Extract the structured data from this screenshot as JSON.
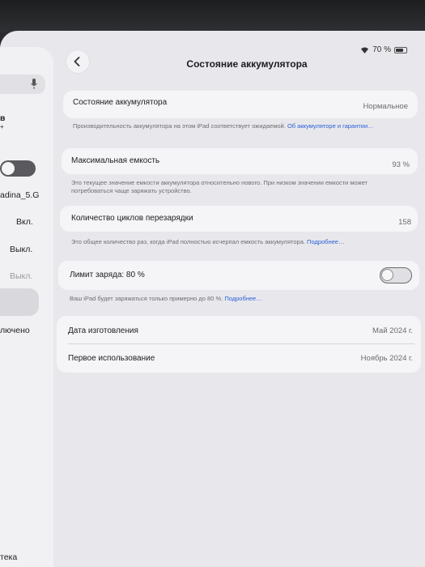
{
  "status_bar": {
    "battery_text": "70 %"
  },
  "sidebar": {
    "items": [
      {
        "label": "в"
      },
      {
        "label": "+"
      },
      {
        "label": "adina_5.G"
      },
      {
        "label": "Вкл."
      },
      {
        "label": "Выкл."
      },
      {
        "label": "Выкл."
      },
      {
        "label": "лючено"
      },
      {
        "label": "тека"
      }
    ]
  },
  "header": {
    "title": "Состояние аккумулятора"
  },
  "sections": {
    "health": {
      "label": "Состояние аккумулятора",
      "value": "Нормальное",
      "footnote": "Производительность аккумулятора на этом iPad соответствует ожидаемой.",
      "link": "Об аккумуляторе и гарантии…"
    },
    "capacity": {
      "label": "Максимальная емкость",
      "value": "93 %",
      "footnote": "Это текущее значение емкости аккумулятора относительно нового. При низком значении емкости может потребоваться чаще заряжать устройство."
    },
    "cycles": {
      "label": "Количество циклов перезарядки",
      "value": "158",
      "footnote": "Это общее количество раз, когда iPad полностью исчерпал емкость аккумулятора.",
      "link": "Подробнее…"
    },
    "limit": {
      "label": "Лимит заряда: 80 %",
      "footnote": "Ваш iPad будет заряжаться только примерно до 80 %.",
      "link": "Подробнее…"
    },
    "dates": {
      "manufactured_label": "Дата изготовления",
      "manufactured_value": "Май 2024 г.",
      "first_use_label": "Первое использование",
      "first_use_value": "Ноябрь 2024 г."
    }
  }
}
